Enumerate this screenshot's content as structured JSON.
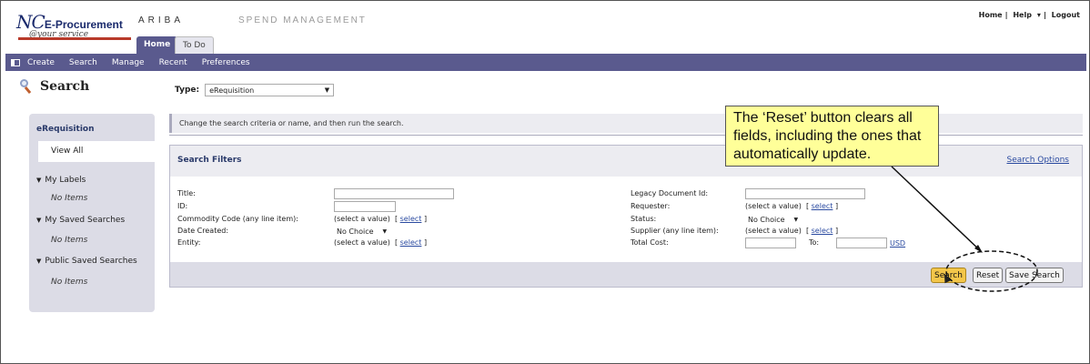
{
  "header": {
    "logo_nc": "NC",
    "logo_eproc": "E-Procurement",
    "logo_tagline": "@your service",
    "ariba": "ARIBA",
    "spend_management": "SPEND MANAGEMENT",
    "top_links": [
      "Home",
      "Help",
      "Logout"
    ],
    "tabs": [
      {
        "label": "Home"
      },
      {
        "label": "To Do"
      }
    ]
  },
  "nav": {
    "items": [
      "Create",
      "Search",
      "Manage",
      "Recent",
      "Preferences"
    ]
  },
  "left_panel": {
    "title": "Search",
    "section_title": "eRequisition",
    "view_all": "View All",
    "groups": [
      {
        "label": "My Labels",
        "empty": "No Items"
      },
      {
        "label": "My Saved Searches",
        "empty": "No Items"
      },
      {
        "label": "Public Saved Searches",
        "empty": "No Items"
      }
    ]
  },
  "type_select": {
    "label": "Type:",
    "value": "eRequisition"
  },
  "info_text": "Change the search criteria or name, and then run the search.",
  "filters": {
    "title": "Search Filters",
    "options_link": "Search Options",
    "left": {
      "title_label": "Title:",
      "id_label": "ID:",
      "commodity_label": "Commodity Code (any line item):",
      "commodity_value": "(select a value)",
      "date_label": "Date Created:",
      "date_value": "No Choice",
      "entity_label": "Entity:",
      "entity_value": "(select a value)"
    },
    "right": {
      "legacy_label": "Legacy Document Id:",
      "requester_label": "Requester:",
      "requester_value": "(select a value)",
      "status_label": "Status:",
      "status_value": "No Choice",
      "supplier_label": "Supplier (any line item):",
      "supplier_value": "(select a value)",
      "total_label": "Total Cost:",
      "to_label": "To:",
      "currency": "USD"
    },
    "select_link": "select",
    "bracket_open": "[",
    "bracket_close": "]"
  },
  "buttons": {
    "search": "Search",
    "reset": "Reset",
    "save_search": "Save Search"
  },
  "callout": {
    "text": "The ‘Reset’ button clears all fields, including the ones that automatically update."
  },
  "colors": {
    "nav_bar": "#5a5a8e",
    "callout_bg": "#ffff99",
    "search_button": "#f3c64a",
    "panel_bg": "#dcdce6"
  }
}
